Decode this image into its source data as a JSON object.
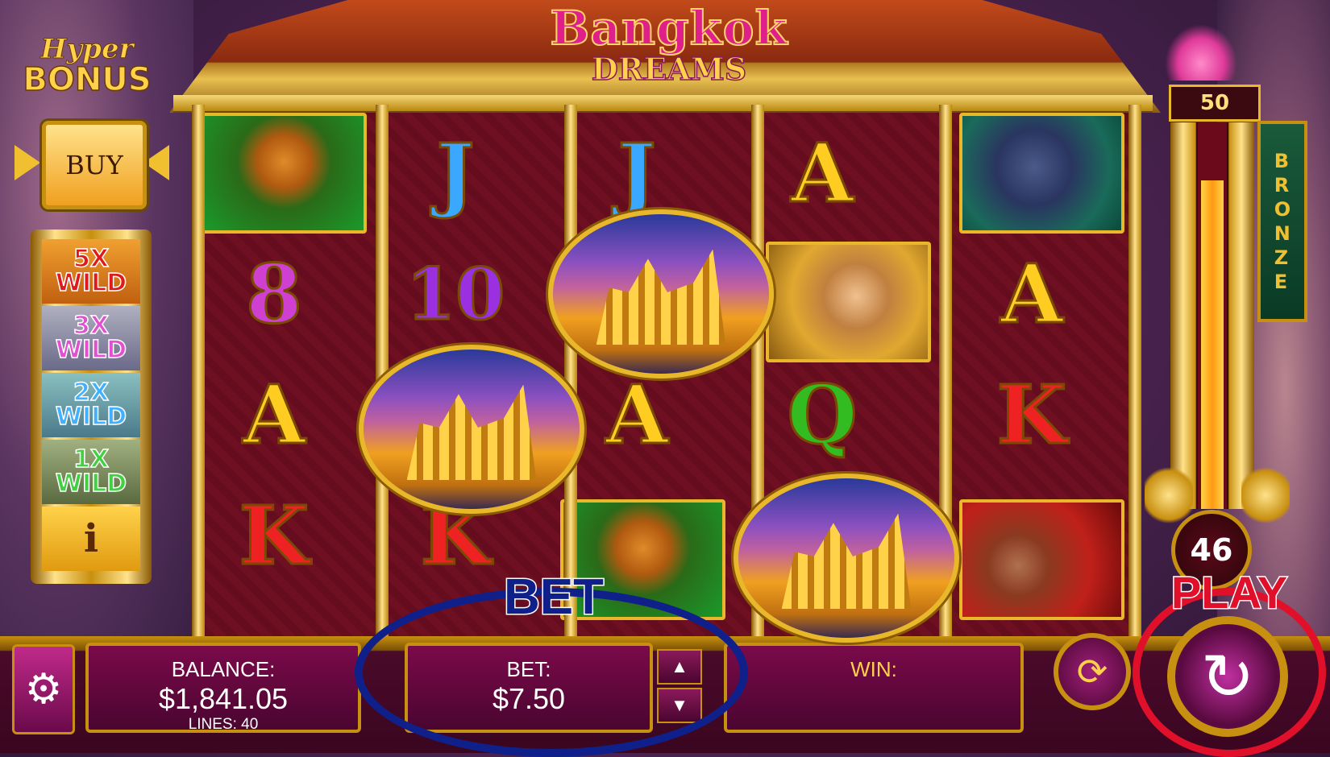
{
  "game": {
    "title_line1": "Bangkok",
    "title_line2": "DREAMS",
    "brand_line1": "Hyper",
    "brand_line2": "BONUS"
  },
  "left_panel": {
    "buy_label": "BUY",
    "multipliers": [
      {
        "mult": "5X",
        "word": "WILD"
      },
      {
        "mult": "3X",
        "word": "WILD"
      },
      {
        "mult": "2X",
        "word": "WILD"
      },
      {
        "mult": "1X",
        "word": "WILD"
      }
    ],
    "info_label": "i"
  },
  "reels": {
    "col1": [
      "tiger",
      "8",
      "A",
      "K"
    ],
    "col2": [
      "J",
      "10",
      "temple",
      "K"
    ],
    "col3": [
      "J",
      "temple",
      "A",
      "tiger"
    ],
    "col4": [
      "A",
      "dancer",
      "Q",
      "temple"
    ],
    "col5": [
      "elephant",
      "A",
      "K",
      "king"
    ]
  },
  "meter": {
    "top_count": "50",
    "tier": "BRONZE",
    "bottom_count": "46",
    "fill_fraction": 0.85
  },
  "bottom_bar": {
    "balance_label": "BALANCE:",
    "balance_value": "$1,841.05",
    "lines_label": "LINES: 40",
    "bet_label": "BET:",
    "bet_value": "$7.50",
    "win_label": "WIN:",
    "win_value": ""
  },
  "callouts": {
    "bet": "BET",
    "play": "PLAY"
  },
  "colors": {
    "gold": "#e8b82a",
    "magenta_panel": "#7a0a4a",
    "bet_callout": "#10208a",
    "play_callout": "#e0102a"
  },
  "icons": {
    "settings": "gear-icon",
    "autoplay": "autoplay-icon",
    "spin": "spin-icon"
  }
}
